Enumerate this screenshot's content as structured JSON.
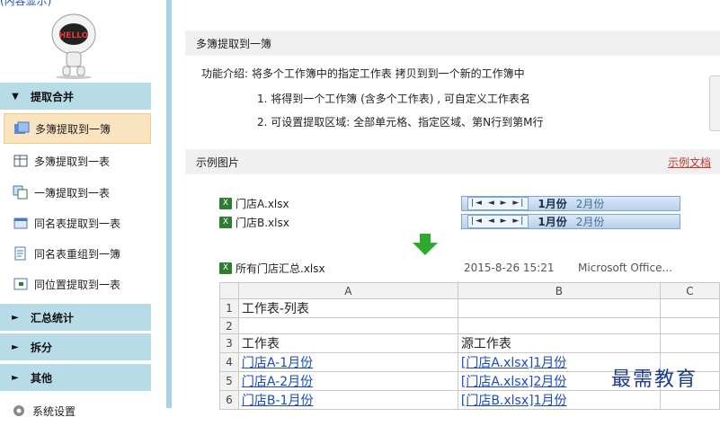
{
  "sidebar": {
    "top_text": "(内容显示)",
    "sections": [
      {
        "label": "提取合并",
        "arrow": "▼"
      },
      {
        "label": "汇总统计",
        "arrow": "►"
      },
      {
        "label": "拆分",
        "arrow": "►"
      },
      {
        "label": "其他",
        "arrow": "►"
      },
      {
        "label": "系统设置"
      }
    ],
    "items": [
      {
        "label": "多簿提取到一簿"
      },
      {
        "label": "多簿提取到一表"
      },
      {
        "label": "一簿提取到一表"
      },
      {
        "label": "同名表提取到一表"
      },
      {
        "label": "同名表重组到一簿"
      },
      {
        "label": "同位置提取到一表"
      }
    ],
    "avatar_text": "HELLO"
  },
  "main": {
    "section1_title": "多簿提取到一簿",
    "intro": "功能介绍: 将多个工作簿中的指定工作表 拷贝到到一个新的工作簿中",
    "point1": "1. 将得到一个工作簿 (含多个工作表) , 可自定义工作表名",
    "point2": "2. 可设置提取区域: 全部单元格、指定区域、第N行到第M行",
    "section2_title": "示例图片",
    "doc_link": "示例文档",
    "files": [
      {
        "name": "门店A.xlsx",
        "tab_active": "1月份",
        "tab_next": "2月份"
      },
      {
        "name": "门店B.xlsx",
        "tab_active": "1月份",
        "tab_next": "2月份"
      }
    ],
    "output_file": {
      "name": "所有门店汇总.xlsx",
      "date": "2015-8-26 15:21",
      "app": "Microsoft Office..."
    },
    "grid": {
      "cols": [
        "A",
        "B",
        "C"
      ],
      "rows": [
        {
          "n": "1",
          "a": "工作表-列表",
          "b": "",
          "link": false
        },
        {
          "n": "2",
          "a": "",
          "b": "",
          "link": false
        },
        {
          "n": "3",
          "a": "工作表",
          "b": "源工作表",
          "link": false
        },
        {
          "n": "4",
          "a": "门店A-1月份",
          "b": "[门店A.xlsx]1月份",
          "link": true
        },
        {
          "n": "5",
          "a": "门店A-2月份",
          "b": "[门店A.xlsx]2月份",
          "link": true
        },
        {
          "n": "6",
          "a": "门店B-1月份",
          "b": "[门店B.xlsx]1月份",
          "link": true
        }
      ]
    },
    "watermark": "最需教育"
  }
}
